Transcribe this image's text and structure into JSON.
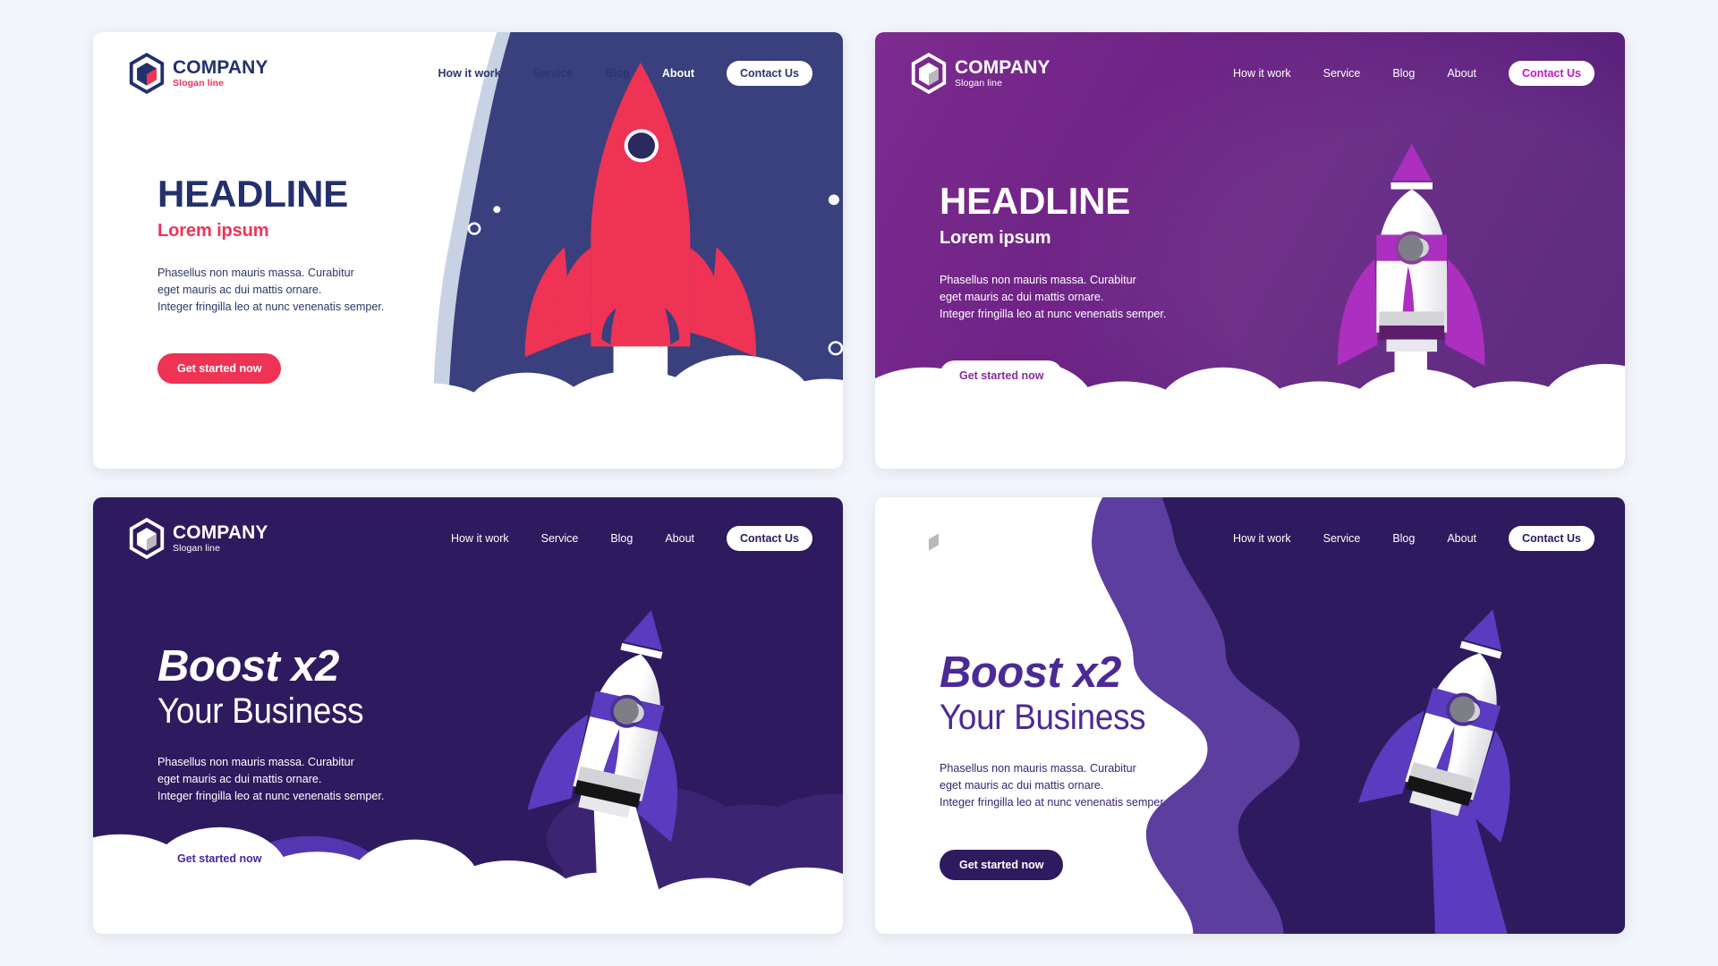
{
  "page": {
    "background_color": "#f2f5fa",
    "title": "Rocket landing page template set"
  },
  "brand": {
    "name": "COMPANY",
    "slogan": "Slogan line",
    "logo_icon": "hexagon-logo-icon"
  },
  "nav": {
    "links": [
      "How it work",
      "Service",
      "Blog",
      "About"
    ],
    "cta_label": "Contact Us"
  },
  "copy": {
    "headline": "HEADLINE",
    "subheadline": "Lorem ipsum",
    "boost_line1": "Boost x2",
    "boost_line2": "Your Business",
    "body": "Phasellus non mauris massa.  Curabitur\neget mauris ac dui mattis ornare.\nInteger fringilla leo at nunc venenatis semper.",
    "cta_label": "Get started now"
  },
  "cards": [
    {
      "id": "card1",
      "variant": "white-navy-pink",
      "background_color": "#ffffff",
      "headline_color": "#23306d",
      "accent_color": "#ef3355",
      "illustration": "red-rocket-launch-night-sky",
      "nav_on_dark_items": [
        "About",
        "Contact Us"
      ]
    },
    {
      "id": "card2",
      "variant": "purple-gradient",
      "background_color": "#6f2486",
      "headline_color": "#ffffff",
      "accent_color": "#c315c7",
      "illustration": "white-magenta-rocket-launch-clouds"
    },
    {
      "id": "card3",
      "variant": "dark-indigo",
      "background_color": "#2e1a5e",
      "headline_color": "#ffffff",
      "accent_color": "#5b3bbf",
      "illustration": "white-purple-rocket-launch-clouds"
    },
    {
      "id": "card4",
      "variant": "white-purple-wave",
      "background_color": "#ffffff",
      "headline_color": "#4c2a96",
      "accent_color": "#2e1a5e",
      "illustration": "white-purple-rocket-diagonal-wave"
    }
  ]
}
